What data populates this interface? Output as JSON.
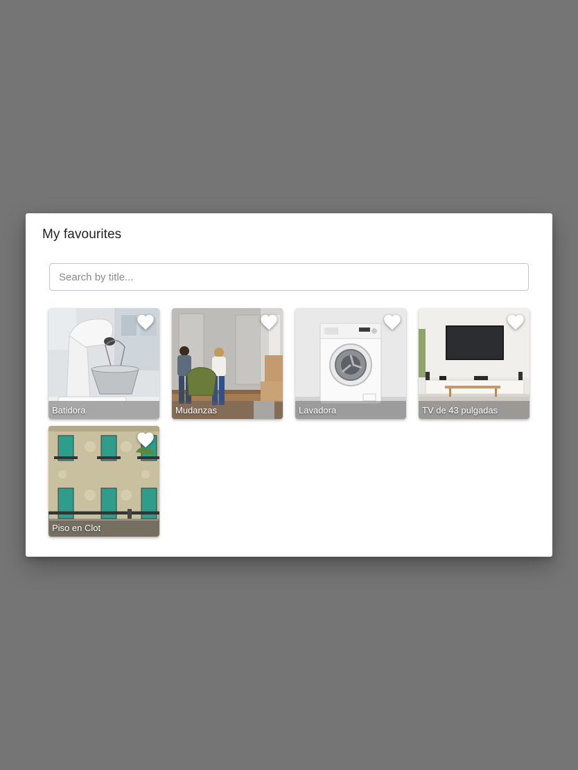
{
  "dialog": {
    "title": "My favourites",
    "search": {
      "placeholder": "Search by title...",
      "value": ""
    }
  },
  "favourites": [
    {
      "title": "Batidora",
      "image": "stand-mixer-photo",
      "favourited": true
    },
    {
      "title": "Mudanzas",
      "image": "people-moving-sofa-photo",
      "favourited": true
    },
    {
      "title": "Lavadora",
      "image": "washing-machine-photo",
      "favourited": true
    },
    {
      "title": "TV de 43 pulgadas",
      "image": "tv-living-room-photo",
      "favourited": true
    },
    {
      "title": "Piso en Clot",
      "image": "building-facade-photo",
      "favourited": true
    }
  ],
  "icons": {
    "favourite": "heart-icon"
  },
  "colors": {
    "backdrop": "#757575",
    "dialog_background": "#ffffff",
    "heart": "#ffffff"
  }
}
